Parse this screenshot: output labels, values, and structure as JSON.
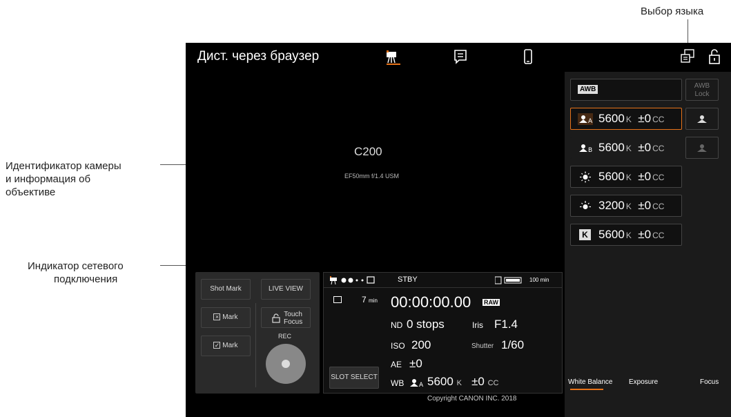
{
  "annotations": {
    "language": "Выбор языка",
    "camera_info_line1": "Идентификатор камеры",
    "camera_info_line2": "и информация об",
    "camera_info_line3": "объективе",
    "network_line1": "Индикатор сетевого",
    "network_line2": "подключения"
  },
  "header": {
    "title": "Дист. через браузер"
  },
  "camera": {
    "id": "C200",
    "lens": "EF50mm f/1.4 USM"
  },
  "white_balance": {
    "awb_label": "AWB",
    "awb_lock_line1": "AWB",
    "awb_lock_line2": "Lock",
    "rows": [
      {
        "icon": "A",
        "kelvin": "5600",
        "k_unit": "K",
        "cc": "±0",
        "cc_unit": "CC"
      },
      {
        "icon": "B",
        "kelvin": "5600",
        "k_unit": "K",
        "cc": "±0",
        "cc_unit": "CC"
      },
      {
        "icon": "sun",
        "kelvin": "5600",
        "k_unit": "K",
        "cc": "±0",
        "cc_unit": "CC"
      },
      {
        "icon": "lamp",
        "kelvin": "3200",
        "k_unit": "K",
        "cc": "±0",
        "cc_unit": "CC"
      },
      {
        "icon": "K",
        "kelvin": "5600",
        "k_unit": "K",
        "cc": "±0",
        "cc_unit": "CC"
      }
    ]
  },
  "tabs": {
    "white_balance": "White Balance",
    "exposure": "Exposure",
    "focus": "Focus"
  },
  "controls": {
    "shot_mark": "Shot Mark",
    "live_view": "LIVE VIEW",
    "x_mark": "Mark",
    "touch_focus_line1": "Touch",
    "touch_focus_line2": "Focus",
    "check_mark": "Mark",
    "rec": "REC",
    "slot_select": "SLOT SELECT"
  },
  "status": {
    "mode": "STBY",
    "battery": "100 min",
    "card_time": "7",
    "card_unit": "min",
    "timecode": "00:00:00.00",
    "raw": "RAW",
    "nd_label": "ND",
    "nd_value": "0 stops",
    "iris_label": "Iris",
    "iris_value": "F1.4",
    "iso_label": "ISO",
    "iso_value": "200",
    "shutter_label": "Shutter",
    "shutter_value": "1/60",
    "ae_label": "AE",
    "ae_value": "±0",
    "wb_label": "WB",
    "wb_value": "5600",
    "wb_unit": "K",
    "wb_cc": "±0",
    "wb_cc_unit": "CC",
    "wb_preset": "A"
  },
  "footer": {
    "copyright": "Copyright CANON INC. 2018"
  },
  "colors": {
    "accent": "#e8731a",
    "background": "#000000",
    "panel": "#1b1b1b"
  }
}
